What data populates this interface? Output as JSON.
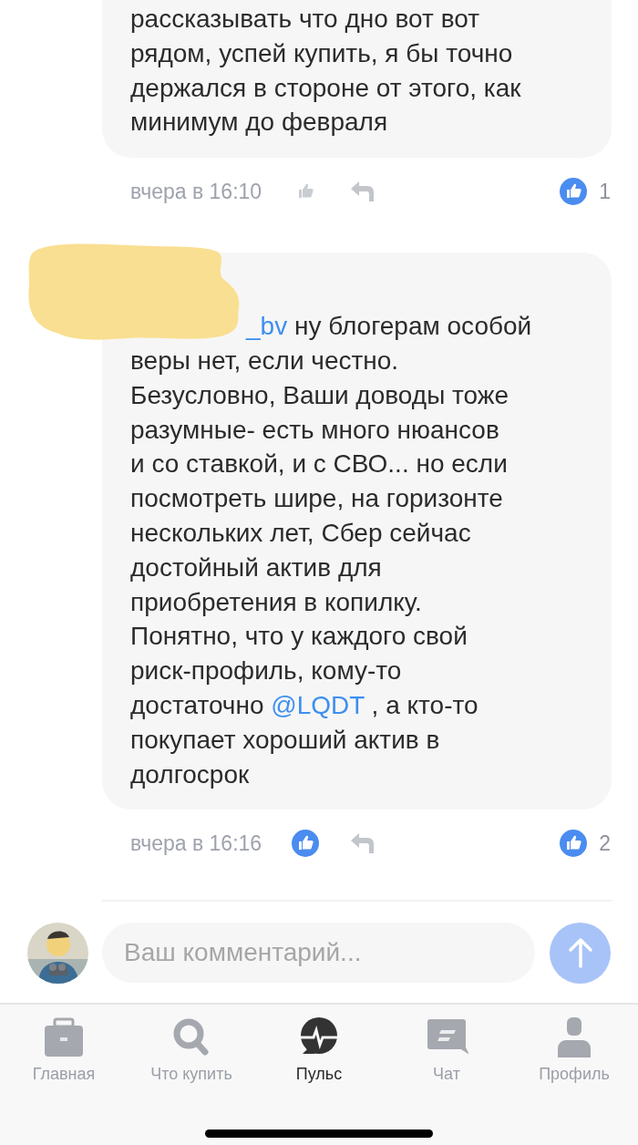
{
  "comments": [
    {
      "lines": [
        [
          {
            "kind": "text",
            "text": "рассказывать что дно вот вот"
          }
        ],
        [
          {
            "kind": "text",
            "text": "рядом, успей купить, я бы точно"
          }
        ],
        [
          {
            "kind": "text",
            "text": "держался в стороне от этого, как"
          }
        ],
        [
          {
            "kind": "text",
            "text": "минимум до февраля"
          }
        ]
      ],
      "redacted": false,
      "time": "вчера в 16:10",
      "liked": false,
      "likes": "1"
    },
    {
      "lines": [
        [
          {
            "kind": "mention",
            "text": "_bv"
          },
          {
            "kind": "text",
            "text": " ну блогерам особой"
          }
        ],
        [
          {
            "kind": "text",
            "text": "веры нет, если честно."
          }
        ],
        [
          {
            "kind": "text",
            "text": "Безусловно, Ваши доводы тоже"
          }
        ],
        [
          {
            "kind": "text",
            "text": "разумные- есть много нюансов"
          }
        ],
        [
          {
            "kind": "text",
            "text": "и со ставкой, и с СВО... но если"
          }
        ],
        [
          {
            "kind": "text",
            "text": "посмотреть шире, на горизонте"
          }
        ],
        [
          {
            "kind": "text",
            "text": "нескольких лет, Сбер сейчас"
          }
        ],
        [
          {
            "kind": "text",
            "text": "достойный актив для"
          }
        ],
        [
          {
            "kind": "text",
            "text": "приобретения в копилку."
          }
        ],
        [
          {
            "kind": "text",
            "text": "Понятно, что у каждого свой"
          }
        ],
        [
          {
            "kind": "text",
            "text": "риск-профиль, кому-то"
          }
        ],
        [
          {
            "kind": "text",
            "text": "достаточно "
          },
          {
            "kind": "mention",
            "text": "@LQDT"
          },
          {
            "kind": "text",
            "text": " , а кто-то"
          }
        ],
        [
          {
            "kind": "text",
            "text": "покупает хороший актив в"
          }
        ],
        [
          {
            "kind": "text",
            "text": "долгосрок"
          }
        ]
      ],
      "redacted": true,
      "time": "вчера в 16:16",
      "liked": true,
      "likes": "2"
    }
  ],
  "composer": {
    "placeholder": "Ваш комментарий..."
  },
  "tabs": [
    {
      "label": "Главная",
      "selected": false
    },
    {
      "label": "Что купить",
      "selected": false
    },
    {
      "label": "Пульс",
      "selected": true
    },
    {
      "label": "Чат",
      "selected": false
    },
    {
      "label": "Профиль",
      "selected": false
    }
  ]
}
